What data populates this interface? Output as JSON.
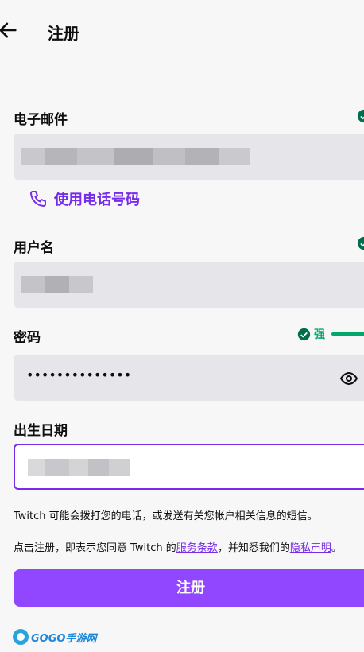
{
  "header": {
    "title": "注册",
    "back_icon": "arrow-left-icon"
  },
  "email": {
    "label": "电子邮件",
    "valid": true
  },
  "use_phone": {
    "label": "使用电话号码",
    "icon": "phone-icon"
  },
  "username": {
    "label": "用户名",
    "valid": true
  },
  "password": {
    "label": "密码",
    "value": "••••••••••••••",
    "strength_label": "强",
    "eye_icon": "eye-icon"
  },
  "birthday": {
    "label": "出生日期"
  },
  "notice_sms": "Twitch 可能会拨打您的电话，或发送有关您帐户相关信息的短信。",
  "terms": {
    "prefix": "点击注册，即表示您同意 Twitch 的",
    "tos_link": "服务条款",
    "middle": "，并知悉我们的",
    "privacy_link": "隐私声明",
    "suffix": "。"
  },
  "submit_label": "注册",
  "watermark": {
    "brand": "GOGO手游网"
  },
  "colors": {
    "accent": "#9147ff",
    "link": "#772ce8",
    "success": "#00a86b",
    "field_bg": "#e6e6ea"
  }
}
